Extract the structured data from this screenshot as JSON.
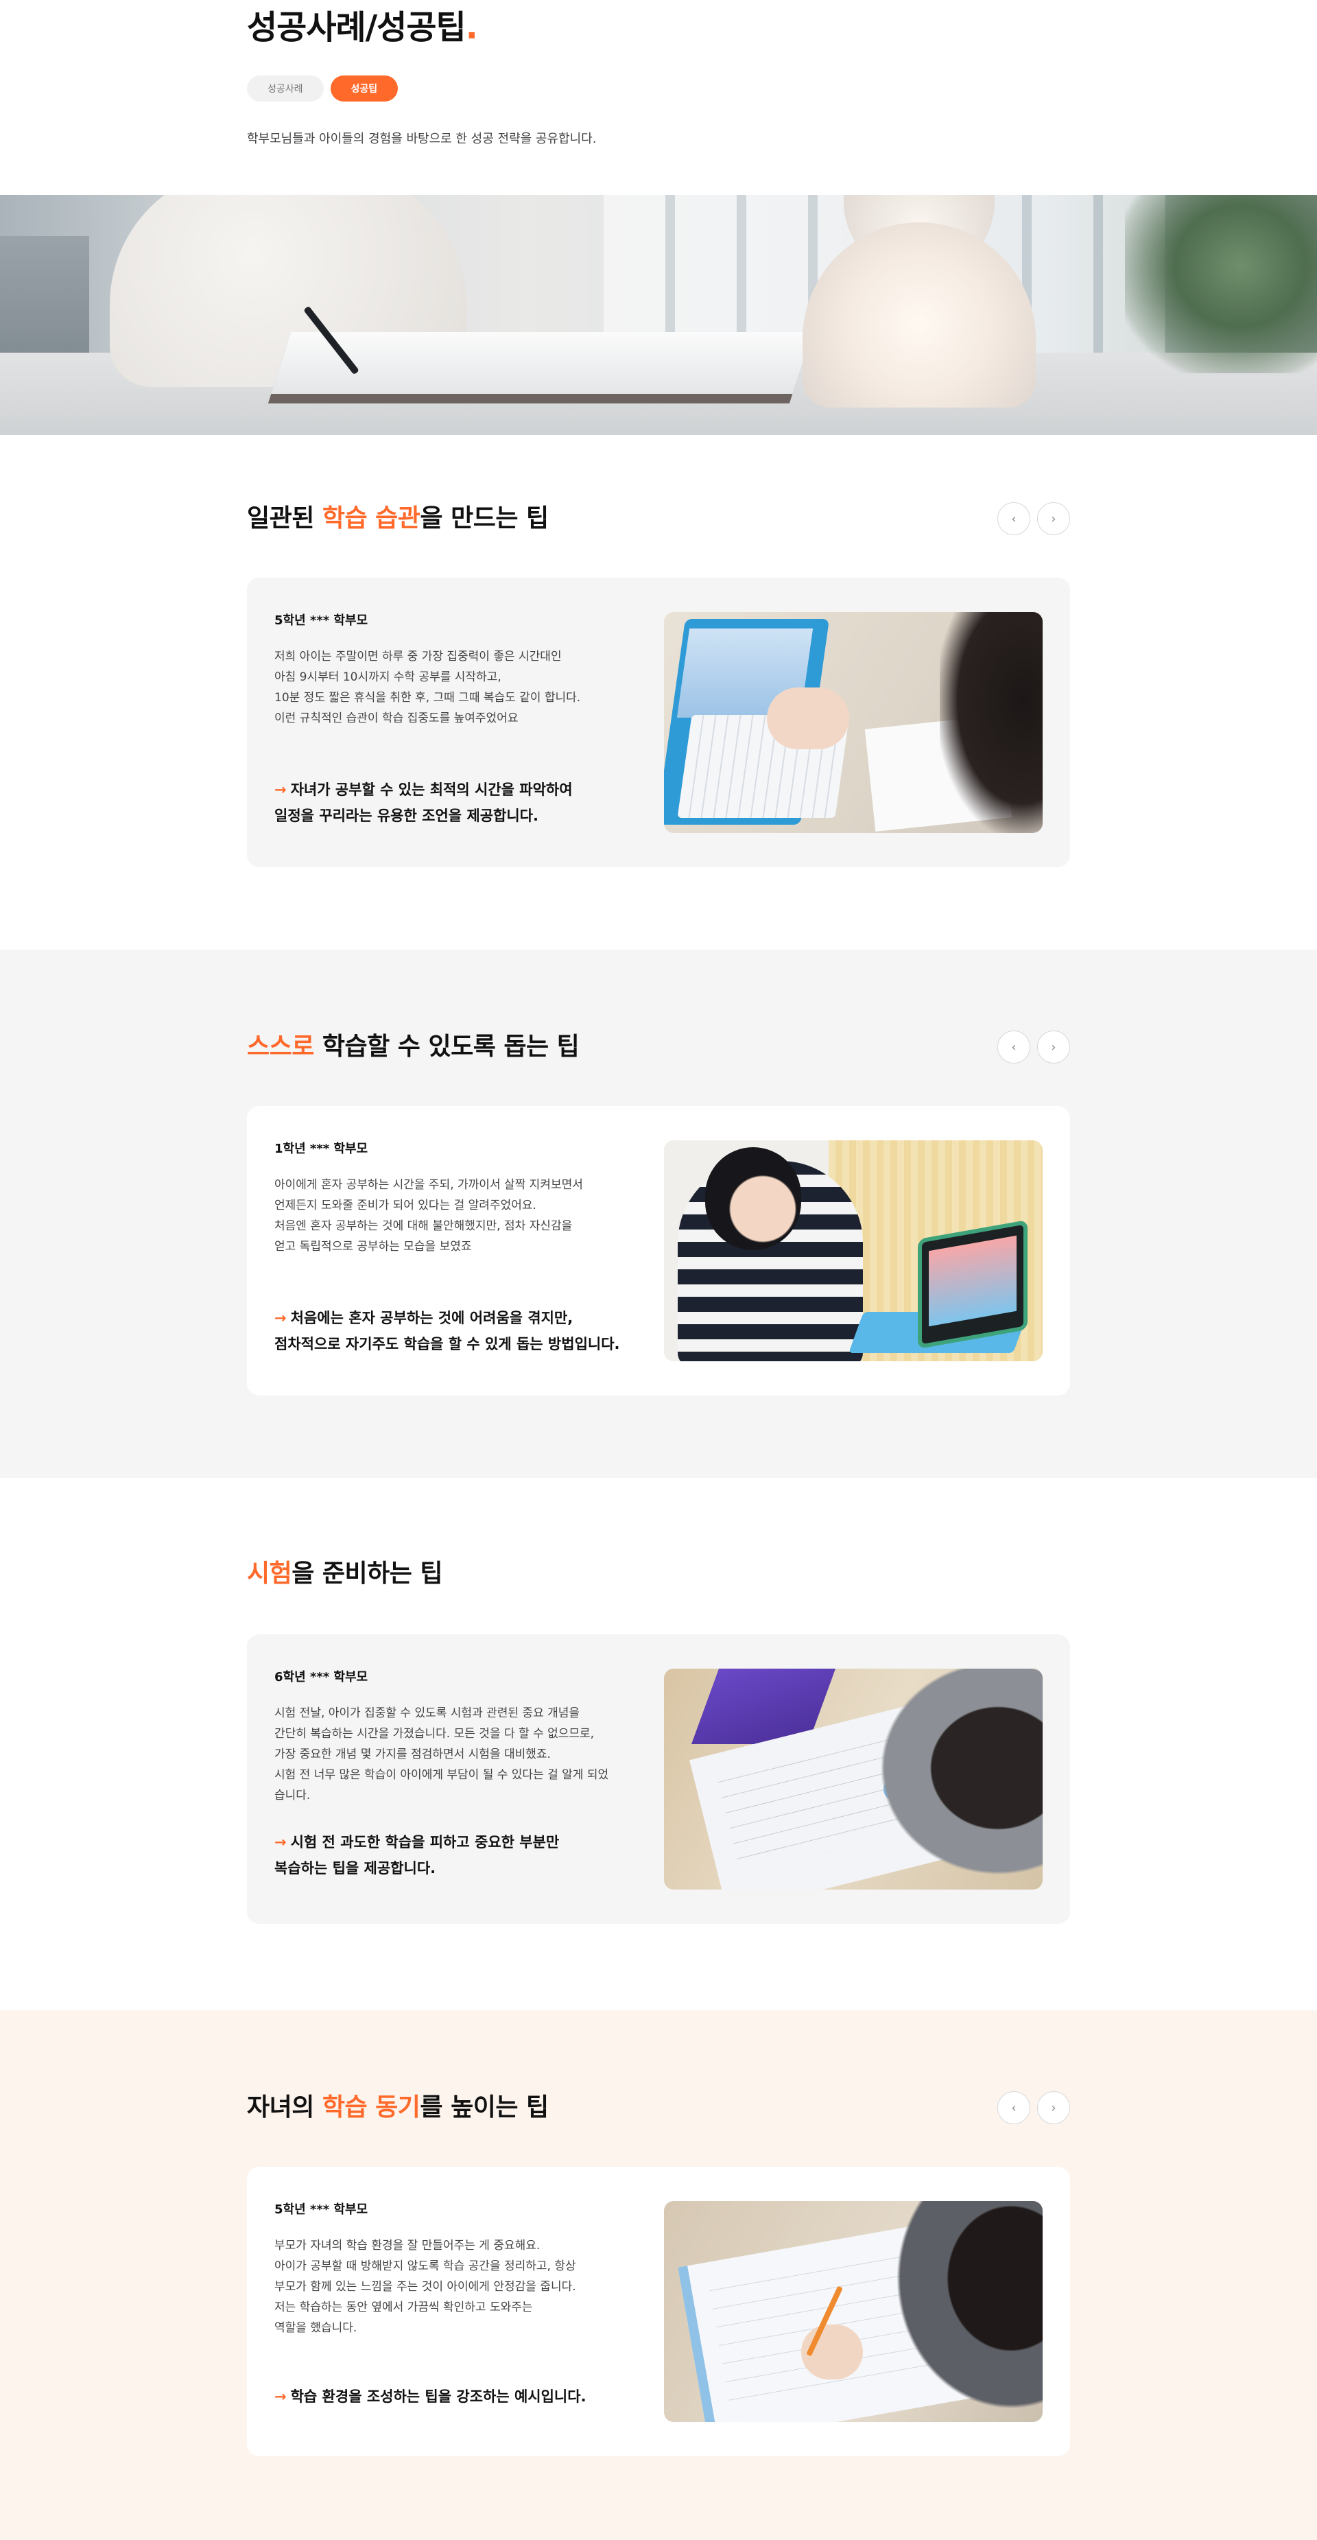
{
  "header": {
    "title": "성공사례/성공팁",
    "title_dot": ".",
    "tabs": [
      {
        "label": "성공사례",
        "active": false
      },
      {
        "label": "성공팁",
        "active": true
      }
    ],
    "intro": "학부모님들과 아이들의 경험을 바탕으로 한 성공 전략을 공유합니다."
  },
  "hero": {
    "alt": "hero-photo"
  },
  "nav": {
    "prev_icon": "chevron-left-icon",
    "next_icon": "chevron-right-icon",
    "prev": "‹",
    "next": "›"
  },
  "sections": [
    {
      "title_pre": "일관된 ",
      "title_hl": "학습 습관",
      "title_post": "을 만드는 팁",
      "author": "5학년 *** 학부모",
      "body": [
        "저희 아이는 주말이면 하루 중 가장 집중력이 좋은 시간대인",
        "아침 9시부터 10시까지 수학 공부를 시작하고,",
        "10분 정도 짧은 휴식을 취한 후, 그때 그때 복습도 같이 합니다.",
        "이런 규칙적인 습관이 학습 집중도를 높여주었어요"
      ],
      "highlight": [
        "자녀가 공부할 수 있는 최적의 시간을 파악하여",
        "일정을 꾸리라는 유용한 조언을 제공합니다."
      ]
    },
    {
      "title_pre": "",
      "title_hl": "스스로",
      "title_post": " 학습할 수 있도록 돕는 팁",
      "author": "1학년 *** 학부모",
      "body": [
        "아이에게 혼자 공부하는 시간을 주되, 가까이서 살짝 지켜보면서",
        "언제든지 도와줄 준비가 되어 있다는 걸 알려주었어요.",
        "처음엔 혼자 공부하는 것에 대해 불안해했지만, 점차 자신감을",
        "얻고 독립적으로 공부하는 모습을 보였죠"
      ],
      "highlight": [
        "처음에는 혼자 공부하는 것에 어려움을 겪지만,",
        "점차적으로 자기주도 학습을 할 수 있게 돕는 방법입니다."
      ]
    },
    {
      "title_pre": "",
      "title_hl": "시험",
      "title_post": "을 준비하는 팁",
      "author": "6학년 *** 학부모",
      "body": [
        "시험 전날, 아이가 집중할 수 있도록 시험과 관련된 중요 개념을",
        "간단히 복습하는 시간을 가졌습니다. 모든 것을 다 할 수 없으므로,",
        "가장 중요한 개념 몇 가지를 점검하면서 시험을 대비했죠.",
        "시험 전 너무 많은 학습이 아이에게 부담이 될 수 있다는 걸 알게 되었",
        "습니다."
      ],
      "highlight": [
        "시험 전 과도한 학습을 피하고 중요한 부분만",
        "복습하는 팁을 제공합니다."
      ]
    },
    {
      "title_pre": "자녀의 ",
      "title_hl": "학습 동기",
      "title_post": "를 높이는 팁",
      "author": "5학년 *** 학부모",
      "body": [
        "부모가 자녀의 학습 환경을 잘 만들어주는 게 중요해요.",
        "아이가 공부할 때 방해받지 않도록 학습 공간을 정리하고, 항상",
        "부모가 함께 있는 느낌을 주는 것이 아이에게 안정감을 줍니다.",
        "저는 학습하는 동안 옆에서 가끔씩 확인하고 도와주는",
        "역할을 했습니다."
      ],
      "highlight": [
        "학습 환경을 조성하는 팁을 강조하는 예시입니다."
      ]
    }
  ],
  "colors": {
    "accent": "#ff6a2b",
    "section_gray": "#f5f5f5",
    "section_peach": "#fdf4ee",
    "card_gray": "#f5f5f5"
  }
}
